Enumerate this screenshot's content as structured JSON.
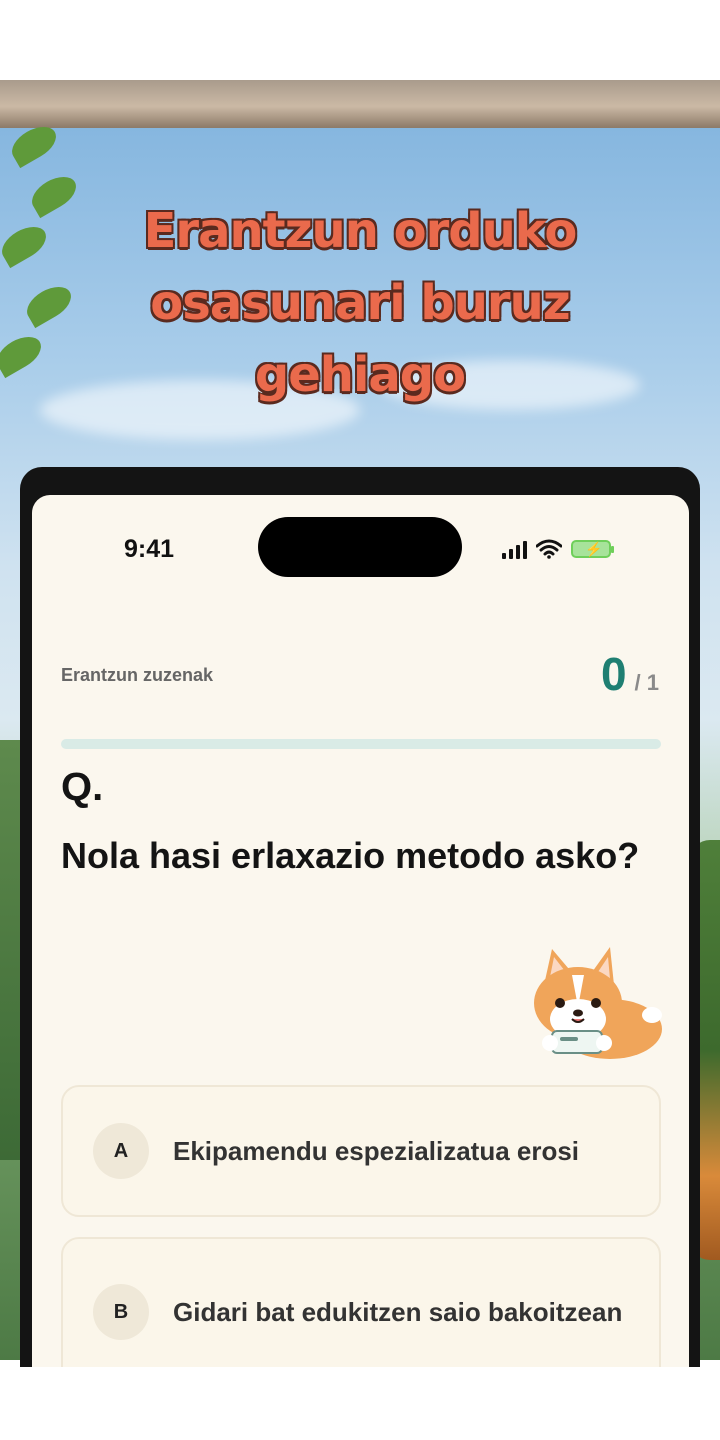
{
  "headline": {
    "line1": "Erantzun orduko",
    "line2": "osasunari buruz",
    "line3": "gehiago"
  },
  "status_bar": {
    "time": "9:41",
    "icons": [
      "cellular-signal-icon",
      "wifi-icon",
      "battery-charging-icon"
    ]
  },
  "quiz": {
    "score_label": "Erantzun zuzenak",
    "score_value": "0",
    "score_total": "/ 1",
    "progress_fraction": 0,
    "question_mark": "Q.",
    "question": "Nola hasi erlaxazio metodo asko?",
    "options": [
      {
        "letter": "A",
        "text": "Ekipamendu espezializatua erosi"
      },
      {
        "letter": "B",
        "text": "Gidari bat edukitzen saio bakoitzean"
      }
    ]
  },
  "colors": {
    "headline": "#ea6a4c",
    "accent": "#1f7f72",
    "screen_bg": "#fbf7ee"
  }
}
